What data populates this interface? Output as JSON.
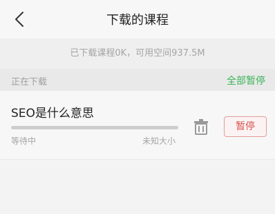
{
  "header": {
    "title": "下载的课程",
    "back_icon": "chevron-left-icon"
  },
  "storage_info": "已下载课程0K，可用空间937.5M",
  "section": {
    "label": "正在下载",
    "pause_all_label": "全部暂停"
  },
  "downloads": [
    {
      "title": "SEO是什么意思",
      "status": "等待中",
      "size": "未知大小",
      "progress": 0,
      "delete_icon": "trash-icon",
      "action_label": "暂停"
    }
  ],
  "colors": {
    "accent_green": "#3cb35a",
    "pause_red": "#d9534f",
    "background": "#f3f3f3"
  }
}
